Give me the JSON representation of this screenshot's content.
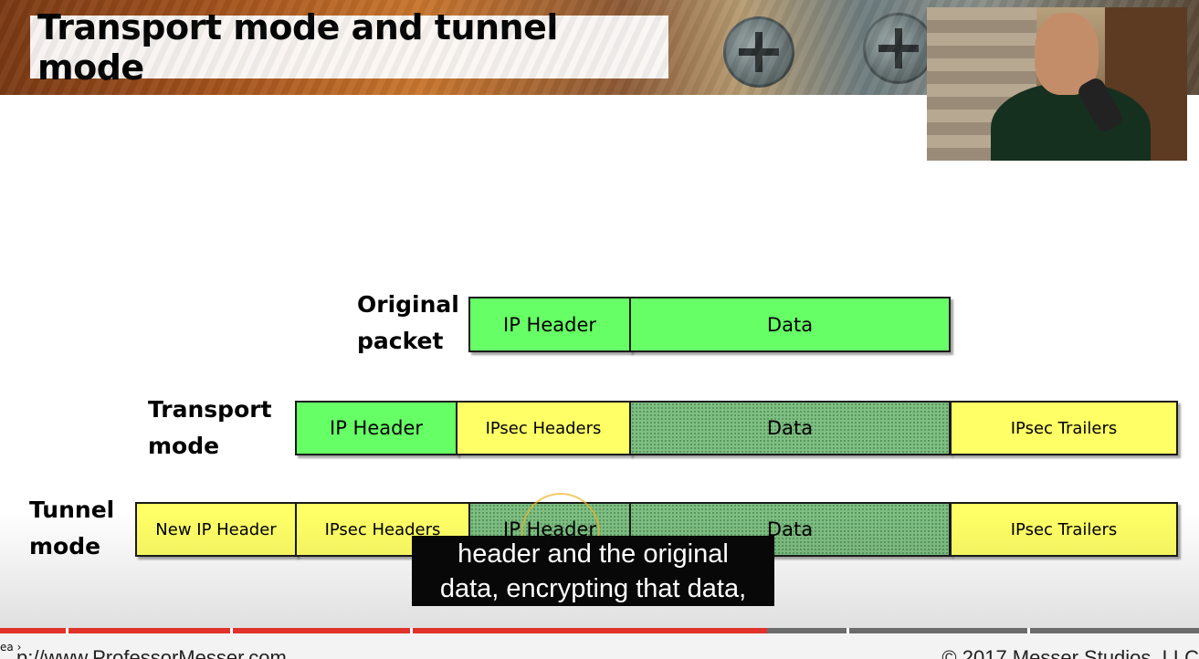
{
  "slide": {
    "title": "Transport mode and tunnel mode",
    "rows": [
      {
        "label_line1": "Original",
        "label_line2": "packet",
        "cells": [
          {
            "text": "IP Header",
            "fill": "green"
          },
          {
            "text": "Data",
            "fill": "green"
          }
        ]
      },
      {
        "label_line1": "Transport",
        "label_line2": "mode",
        "cells": [
          {
            "text": "IP Header",
            "fill": "green"
          },
          {
            "text": "IPsec Headers",
            "fill": "yellow"
          },
          {
            "text": "Data",
            "fill": "encrypted"
          },
          {
            "text": "IPsec Trailers",
            "fill": "yellow"
          }
        ]
      },
      {
        "label_line1": "Tunnel",
        "label_line2": "mode",
        "cells": [
          {
            "text": "New IP Header",
            "fill": "yellow"
          },
          {
            "text": "IPsec Headers",
            "fill": "yellow"
          },
          {
            "text": "IP Header",
            "fill": "encrypted"
          },
          {
            "text": "Data",
            "fill": "encrypted"
          },
          {
            "text": "IPsec Trailers",
            "fill": "yellow"
          }
        ]
      }
    ],
    "colors": {
      "green": "#66ff66",
      "yellow": "#ffff66",
      "encrypted": "#7fbf84"
    }
  },
  "caption": {
    "line1": "header and the original",
    "line2": "data, encrypting that data,"
  },
  "player": {
    "progress_percent": 64,
    "footer_left": "p://www.ProfessorMesser.com",
    "footer_right": "© 2017 Messer Studios, LLC",
    "footer_marker": "ea"
  }
}
